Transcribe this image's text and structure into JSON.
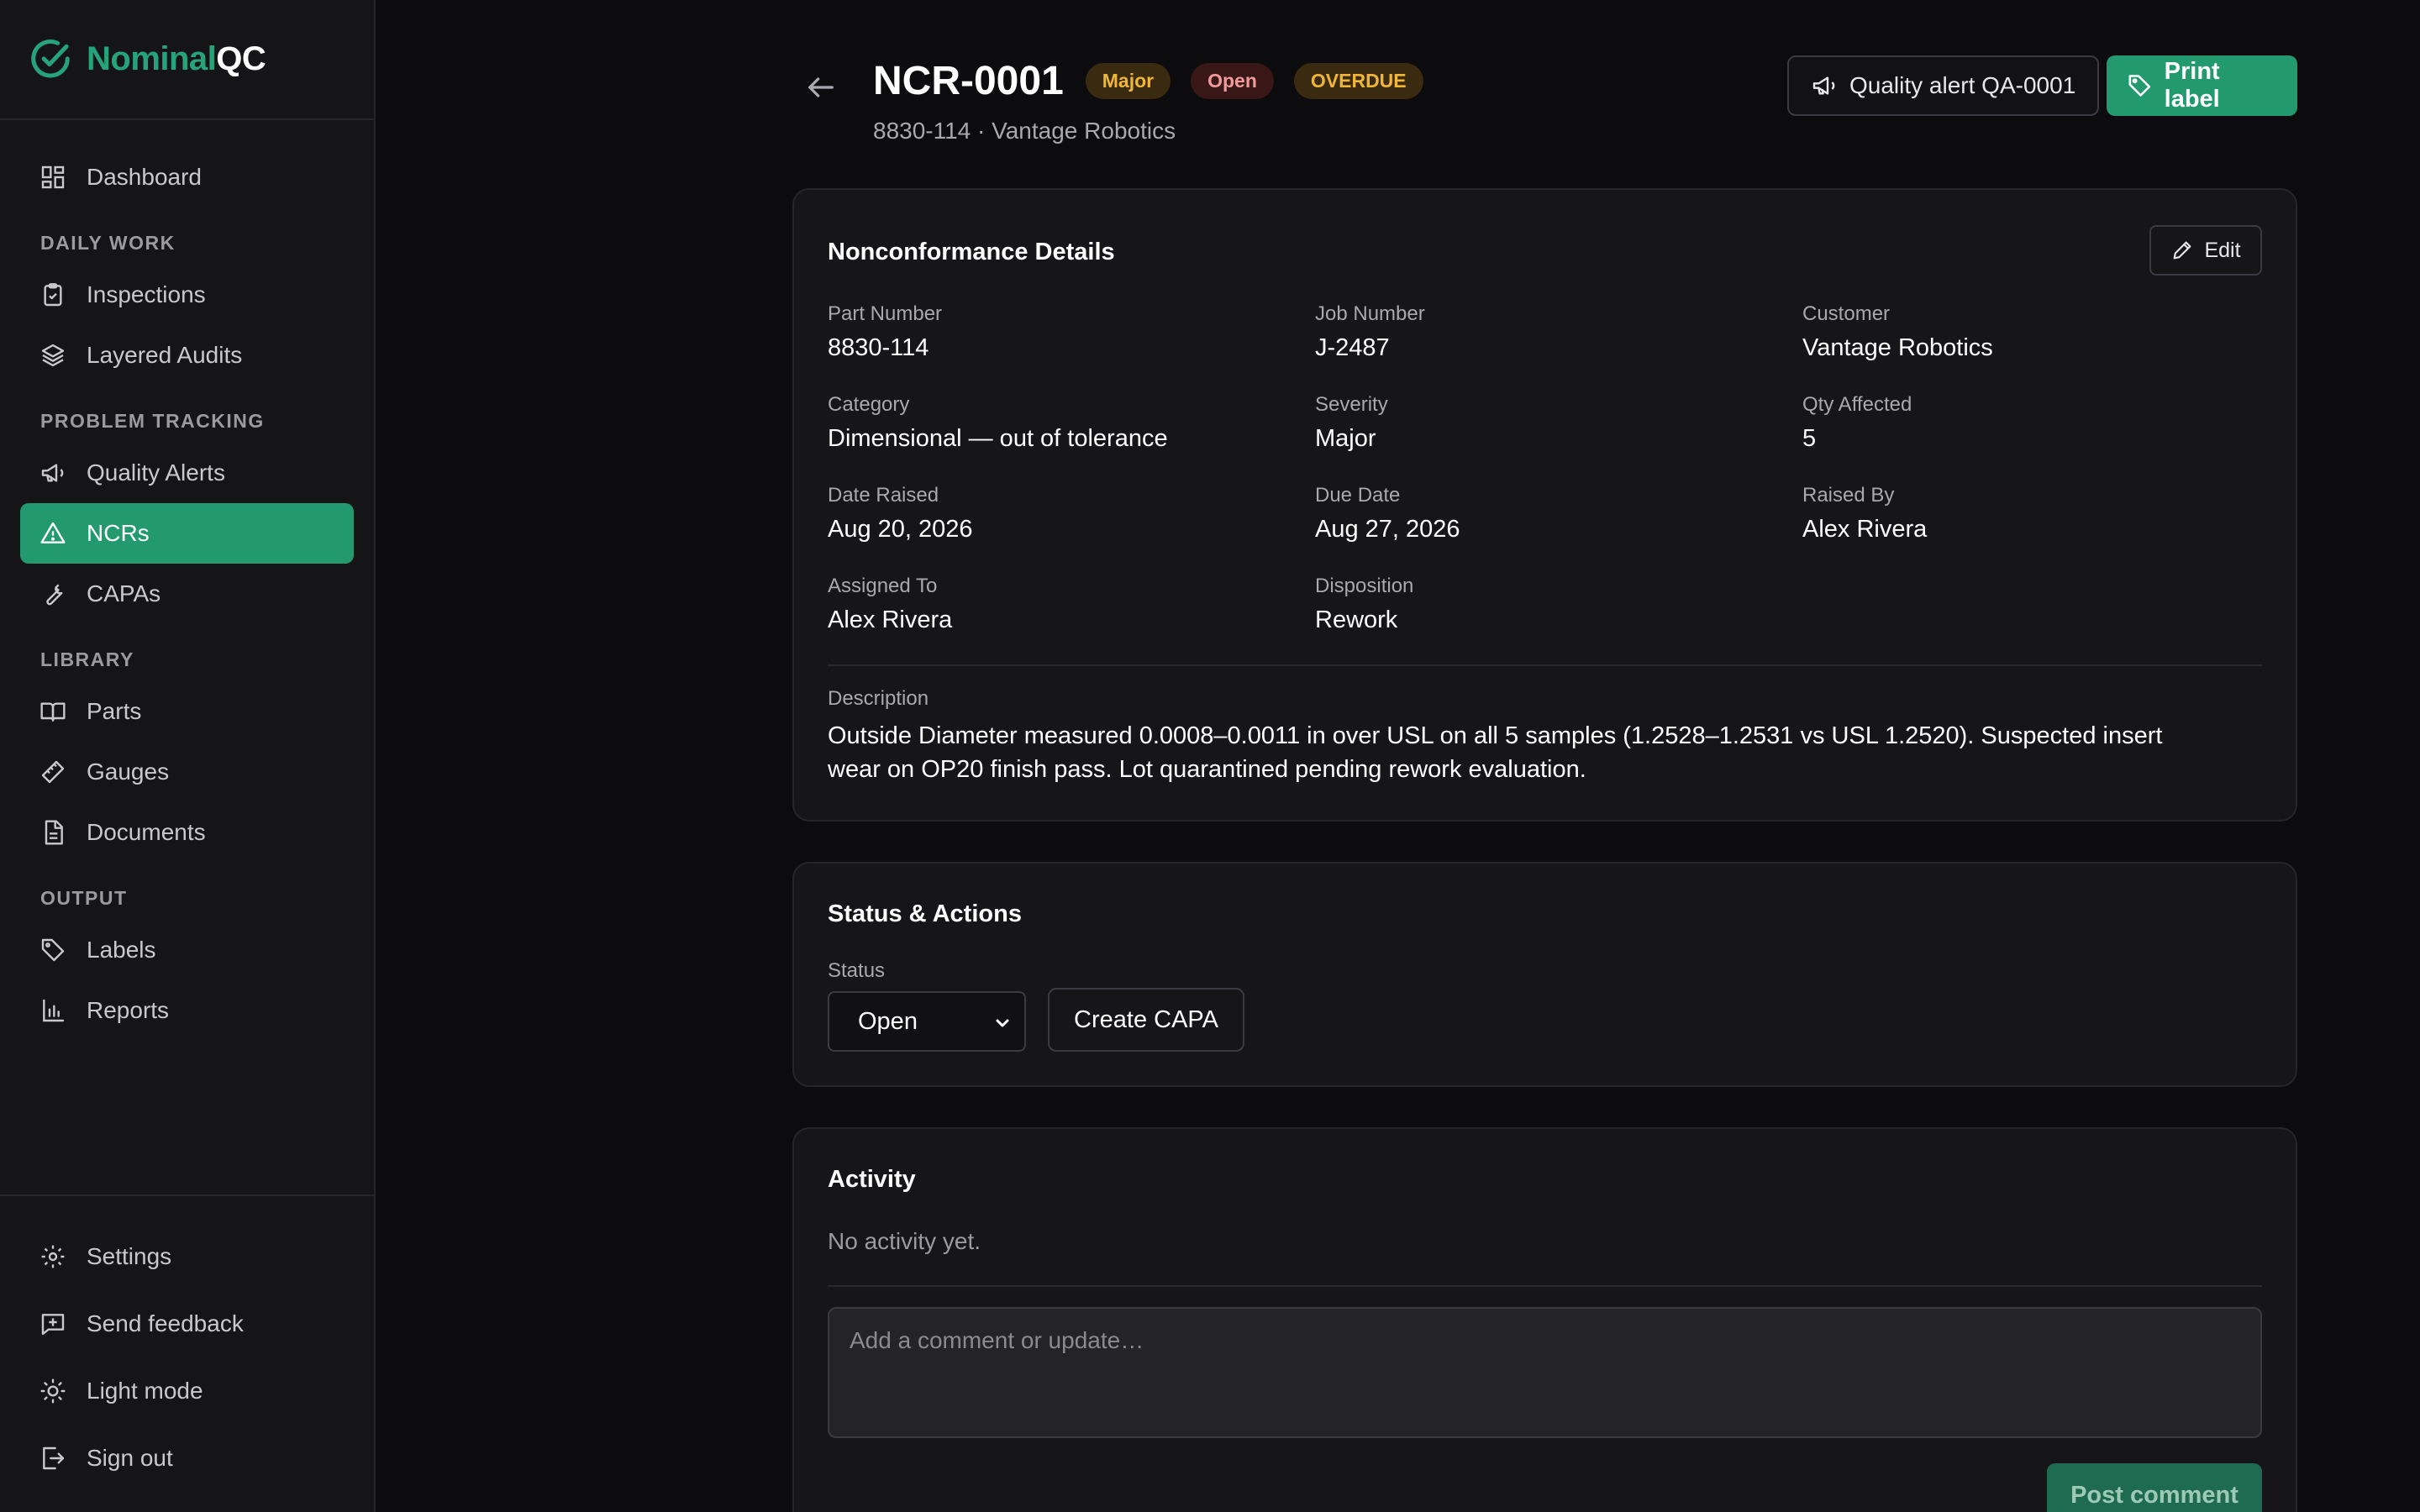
{
  "brand": {
    "name_part1": "Nominal",
    "name_part2": "QC"
  },
  "sidebar": {
    "top_items": [
      {
        "label": "Dashboard",
        "icon": "dashboard-icon"
      }
    ],
    "sections": [
      {
        "title": "DAILY WORK",
        "items": [
          {
            "label": "Inspections",
            "icon": "clipboard-check-icon"
          },
          {
            "label": "Layered Audits",
            "icon": "layers-icon"
          }
        ]
      },
      {
        "title": "PROBLEM TRACKING",
        "items": [
          {
            "label": "Quality Alerts",
            "icon": "megaphone-icon"
          },
          {
            "label": "NCRs",
            "icon": "warning-icon",
            "active": true
          },
          {
            "label": "CAPAs",
            "icon": "wrench-icon"
          }
        ]
      },
      {
        "title": "LIBRARY",
        "items": [
          {
            "label": "Parts",
            "icon": "book-icon"
          },
          {
            "label": "Gauges",
            "icon": "ruler-icon"
          },
          {
            "label": "Documents",
            "icon": "document-icon"
          }
        ]
      },
      {
        "title": "OUTPUT",
        "items": [
          {
            "label": "Labels",
            "icon": "tag-icon"
          },
          {
            "label": "Reports",
            "icon": "bar-chart-icon"
          }
        ]
      }
    ],
    "bottom_items": [
      {
        "label": "Settings",
        "icon": "gear-icon"
      },
      {
        "label": "Send feedback",
        "icon": "feedback-icon"
      },
      {
        "label": "Light mode",
        "icon": "sun-icon"
      },
      {
        "label": "Sign out",
        "icon": "sign-out-icon"
      }
    ]
  },
  "header": {
    "title": "NCR-0001",
    "badges": {
      "severity": "Major",
      "status": "Open",
      "overdue": "OVERDUE"
    },
    "subtitle": "8830-114 · Vantage Robotics",
    "quality_alert_button": "Quality alert QA-0001",
    "print_label_button": "Print label"
  },
  "details": {
    "title": "Nonconformance Details",
    "edit_label": "Edit",
    "fields": {
      "part_number": {
        "label": "Part Number",
        "value": "8830-114"
      },
      "job_number": {
        "label": "Job Number",
        "value": "J-2487"
      },
      "customer": {
        "label": "Customer",
        "value": "Vantage Robotics"
      },
      "category": {
        "label": "Category",
        "value": "Dimensional — out of tolerance"
      },
      "severity": {
        "label": "Severity",
        "value": "Major"
      },
      "qty_affected": {
        "label": "Qty Affected",
        "value": "5"
      },
      "date_raised": {
        "label": "Date Raised",
        "value": "Aug 20, 2026"
      },
      "due_date": {
        "label": "Due Date",
        "value": "Aug 27, 2026"
      },
      "raised_by": {
        "label": "Raised By",
        "value": "Alex Rivera"
      },
      "assigned_to": {
        "label": "Assigned To",
        "value": "Alex Rivera"
      },
      "disposition": {
        "label": "Disposition",
        "value": "Rework"
      }
    },
    "description_label": "Description",
    "description": "Outside Diameter measured 0.0008–0.0011 in over USL on all 5 samples (1.2528–1.2531 vs USL 1.2520). Suspected insert wear on OP20 finish pass. Lot quarantined pending rework evaluation."
  },
  "status_actions": {
    "title": "Status & Actions",
    "status_label": "Status",
    "status_value": "Open",
    "create_capa_label": "Create CAPA"
  },
  "activity": {
    "title": "Activity",
    "empty_text": "No activity yet.",
    "comment_placeholder": "Add a comment or update…",
    "post_label": "Post comment"
  },
  "colors": {
    "accent": "#23996f",
    "background": "#0c0c0e",
    "card": "#161618"
  }
}
